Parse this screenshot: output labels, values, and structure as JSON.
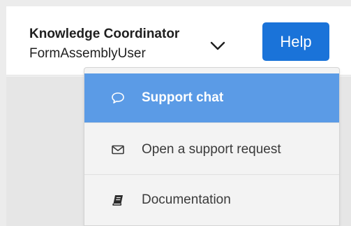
{
  "header": {
    "user_name": "Knowledge Coordinator",
    "organization": "FormAssemblyUser",
    "help_button_label": "Help"
  },
  "help_menu": {
    "items": [
      {
        "label": "Support chat",
        "icon": "speech-bubble-icon",
        "active": true
      },
      {
        "label": "Open a support request",
        "icon": "envelope-icon",
        "active": false
      },
      {
        "label": "Documentation",
        "icon": "book-icon",
        "active": false
      }
    ]
  },
  "colors": {
    "primary_button": "#1a73d9",
    "active_menu_item": "#5b9be6",
    "menu_background": "#f3f3f3",
    "backdrop": "#e6e6e6"
  }
}
